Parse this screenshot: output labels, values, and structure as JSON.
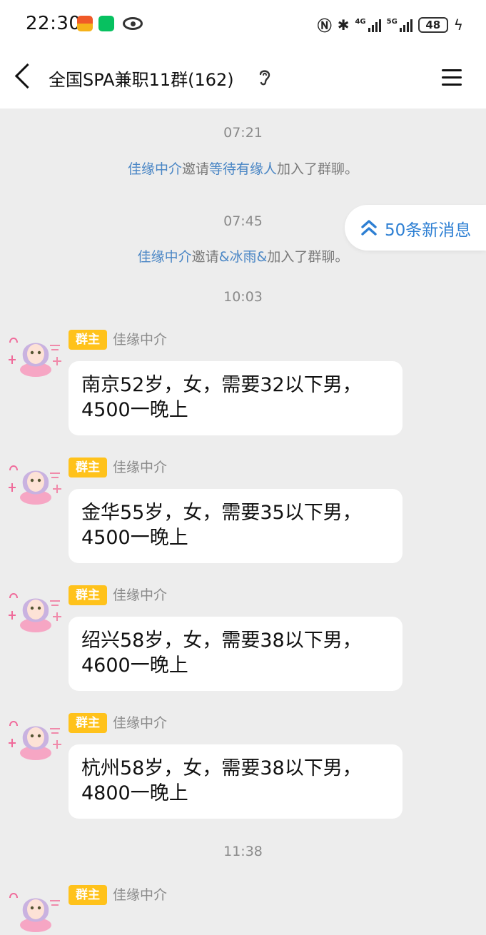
{
  "status_bar": {
    "time": "22:30",
    "battery": "48",
    "network_1": "4G",
    "network_2": "5G"
  },
  "header": {
    "title": "全国SPA兼职11群(162)"
  },
  "new_messages": {
    "label": "50条新消息"
  },
  "chat": {
    "ts1": "07:21",
    "sys1": {
      "inviter": "佳缘中介",
      "verb": "邀请",
      "invitee": "等待有缘人",
      "suffix": "加入了群聊。"
    },
    "ts2": "07:45",
    "sys2": {
      "inviter": "佳缘中介",
      "verb": "邀请",
      "invitee": "&冰雨&",
      "suffix": "加入了群聊。"
    },
    "ts3": "10:03",
    "ts4": "11:38",
    "messages": [
      {
        "role": "群主",
        "sender": "佳缘中介",
        "line1": "南京52岁，女，需要32以下男，",
        "line2": "4500一晚上"
      },
      {
        "role": "群主",
        "sender": "佳缘中介",
        "line1": "金华55岁，女，需要35以下男，",
        "line2": "4500一晚上"
      },
      {
        "role": "群主",
        "sender": "佳缘中介",
        "line1": "绍兴58岁，女，需要38以下男，",
        "line2": "4600一晚上"
      },
      {
        "role": "群主",
        "sender": "佳缘中介",
        "line1": "杭州58岁，女，需要38以下男，",
        "line2": "4800一晚上"
      },
      {
        "role": "群主",
        "sender": "佳缘中介"
      }
    ]
  },
  "colors": {
    "background": "#ededed",
    "badge": "#ffc21b",
    "link": "#4a86c5",
    "accent": "#2d7fd3"
  }
}
